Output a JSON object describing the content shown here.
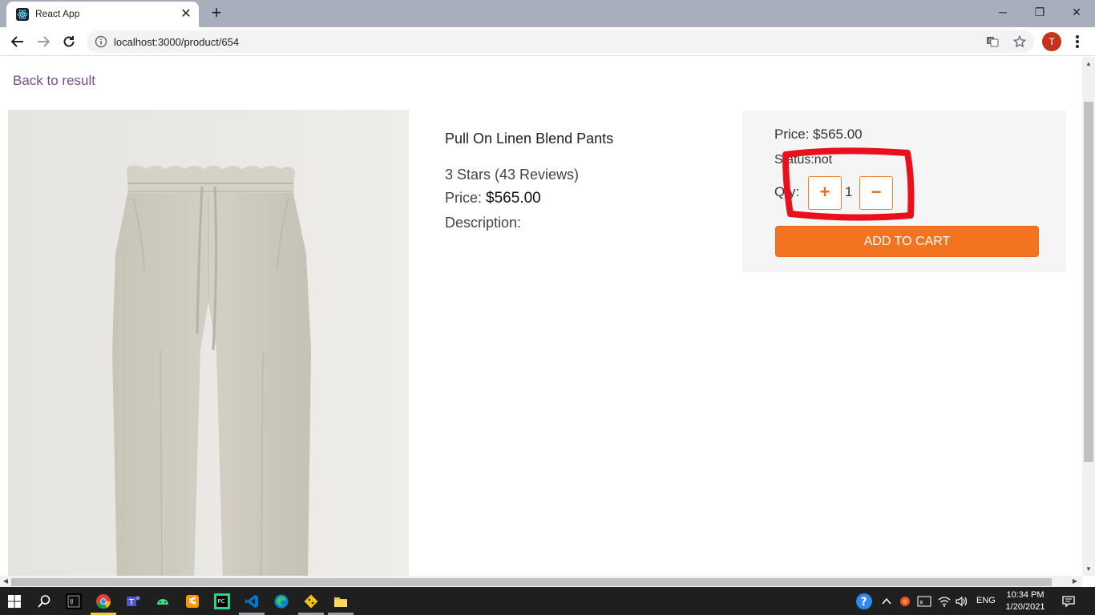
{
  "browser": {
    "tab_title": "React App",
    "url": "localhost:3000/product/654",
    "profile_initial": "T",
    "window_controls": [
      "minimize",
      "restore",
      "close"
    ]
  },
  "page": {
    "back_link": "Back to result",
    "product": {
      "name": "Pull On Linen Blend Pants",
      "rating_text": "3 Stars (43 Reviews)",
      "price_label": "Price:",
      "price_value": "$565.00",
      "description_label": "Description:"
    },
    "buy_box": {
      "price_text": "Price: $565.00",
      "status_text": "Status:not",
      "qty_label": "Qty:",
      "plus_label": "+",
      "minus_label": "−",
      "qty_value": "1",
      "add_to_cart_label": "ADD TO CART"
    }
  },
  "colors": {
    "accent_orange": "#f47321",
    "annotation_red": "#e8101c",
    "link_purple": "#7b4a8e"
  },
  "taskbar": {
    "language": "ENG",
    "time": "10:34 PM",
    "date": "1/20/2021",
    "apps": [
      "start-icon",
      "search-icon",
      "intellij-icon",
      "chrome-icon",
      "teams-icon",
      "android-studio-icon",
      "sublime-icon",
      "pycharm-icon",
      "vscode-icon",
      "edge-icon",
      "git-icon",
      "file-explorer-icon"
    ]
  }
}
